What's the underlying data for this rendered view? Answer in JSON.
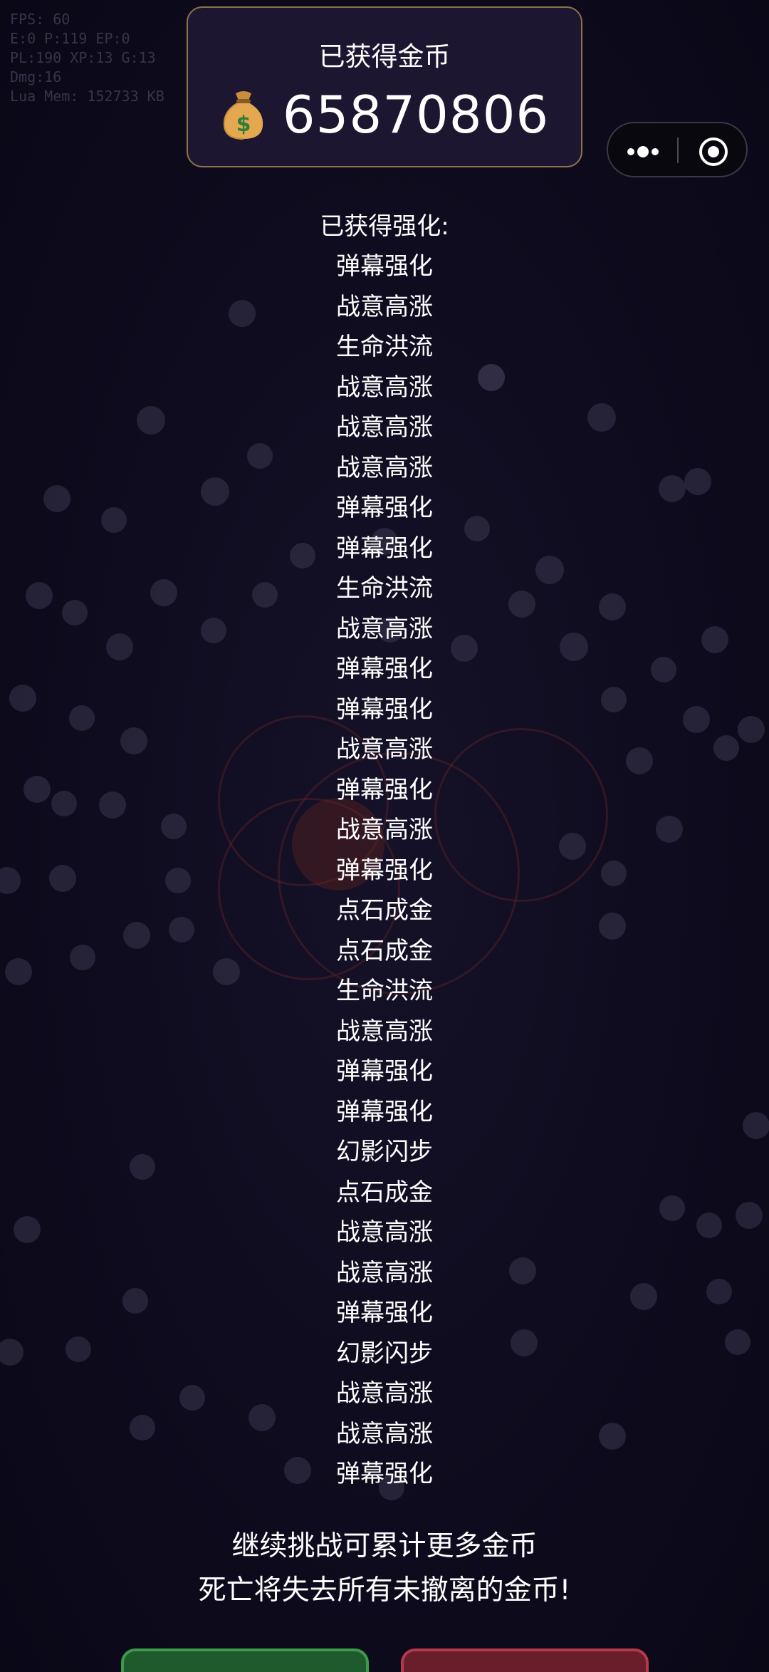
{
  "debug": {
    "fps": "FPS: 60",
    "entities": "E:0 P:119 EP:0",
    "stats": "PL:190 XP:13 G:13",
    "damage": "Dmg:16",
    "memory": "Lua Mem: 152733 KB"
  },
  "gold_panel": {
    "title": "已获得金币",
    "icon": "money-bag-icon",
    "amount": "65870806"
  },
  "capsule_menu": {
    "more_icon": "more-dots-icon",
    "close_icon": "target-close-icon"
  },
  "upgrades": {
    "heading": "已获得强化:",
    "items": [
      "弹幕强化",
      "战意高涨",
      "生命洪流",
      "战意高涨",
      "战意高涨",
      "战意高涨",
      "弹幕强化",
      "弹幕强化",
      "生命洪流",
      "战意高涨",
      "弹幕强化",
      "弹幕强化",
      "战意高涨",
      "弹幕强化",
      "战意高涨",
      "弹幕强化",
      "点石成金",
      "点石成金",
      "生命洪流",
      "战意高涨",
      "弹幕强化",
      "弹幕强化",
      "幻影闪步",
      "点石成金",
      "战意高涨",
      "战意高涨",
      "弹幕强化",
      "幻影闪步",
      "战意高涨",
      "战意高涨",
      "弹幕强化"
    ]
  },
  "warning": {
    "line1": "继续挑战可累计更多金币",
    "line2": "死亡将失去所有未撤离的金币!"
  },
  "colors": {
    "background": "#0e0b1f",
    "panel_border": "#8a7448",
    "button_green": "#3c9a4a",
    "button_red": "#b5394b"
  }
}
